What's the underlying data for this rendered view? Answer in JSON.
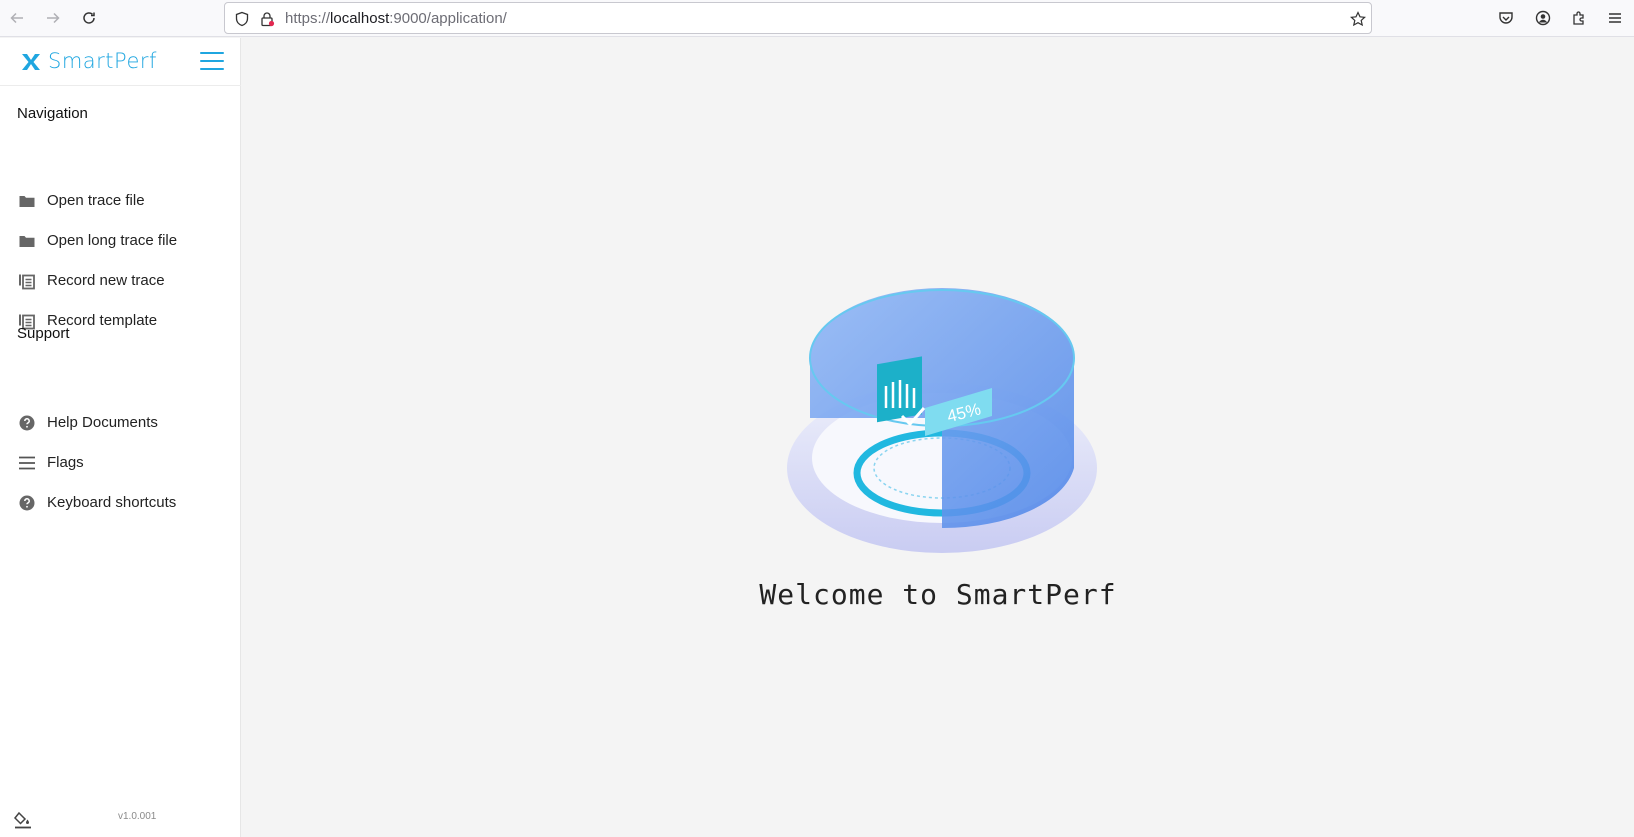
{
  "browser": {
    "url_scheme": "https://",
    "url_host": "localhost",
    "url_rest": ":9000/application/"
  },
  "app": {
    "name": "SmartPerf",
    "accent_color": "#1fa6e0",
    "version": "v1.0.001"
  },
  "sidebar": {
    "sections": [
      {
        "title": "Navigation",
        "items": [
          {
            "label": "Open trace file",
            "icon": "folder-icon"
          },
          {
            "label": "Open long trace file",
            "icon": "folder-icon"
          },
          {
            "label": "Record new trace",
            "icon": "copy-icon"
          },
          {
            "label": "Record template",
            "icon": "copy-icon"
          }
        ]
      },
      {
        "title": "Support",
        "items": [
          {
            "label": "Help Documents",
            "icon": "help-icon"
          },
          {
            "label": "Flags",
            "icon": "menu-lines-icon"
          },
          {
            "label": "Keyboard shortcuts",
            "icon": "help-icon"
          }
        ]
      }
    ]
  },
  "main": {
    "welcome": "Welcome to SmartPerf",
    "illustration_badge": "45%"
  }
}
